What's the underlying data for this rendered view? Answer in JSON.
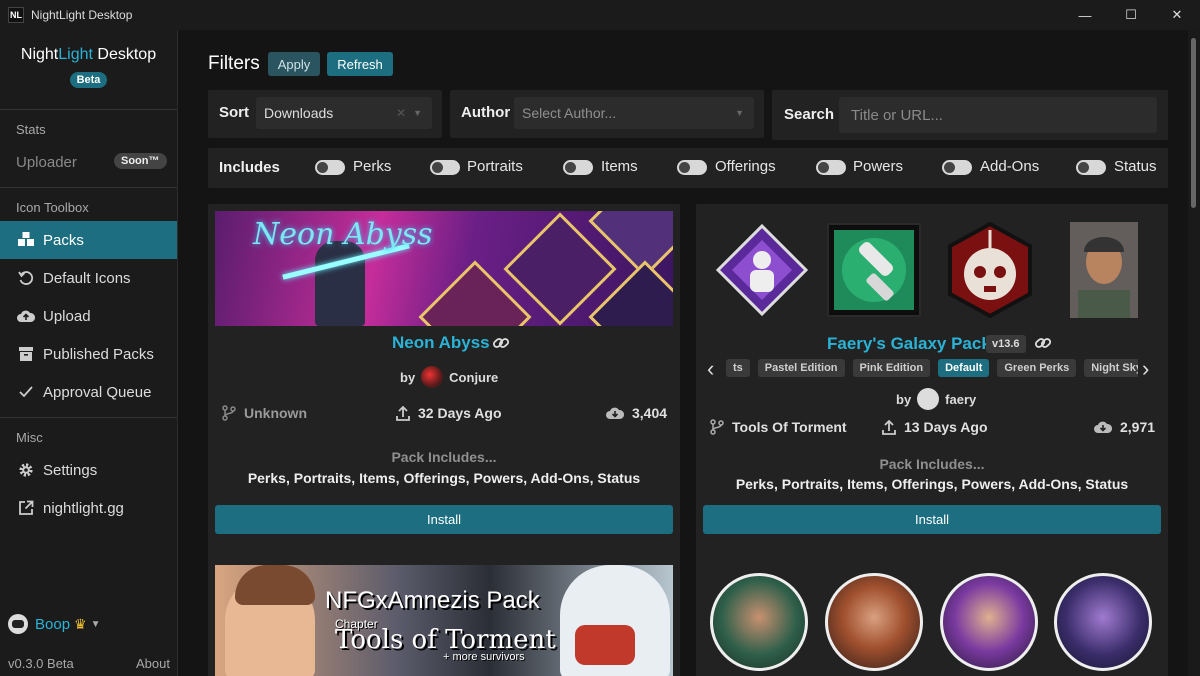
{
  "window": {
    "logo": "NL",
    "title": "NightLight Desktop",
    "minimize": "—",
    "maximize": "☐",
    "close": "✕"
  },
  "sidebar": {
    "brand_part1": "Night",
    "brand_part2": "Light",
    "brand_part3": " Desktop",
    "beta": "Beta",
    "section_stats": "Stats",
    "uploader": "Uploader",
    "soon": "Soon™",
    "section_toolbox": "Icon Toolbox",
    "packs": "Packs",
    "default_icons": "Default Icons",
    "upload": "Upload",
    "published_packs": "Published Packs",
    "approval_queue": "Approval Queue",
    "section_misc": "Misc",
    "settings": "Settings",
    "website": "nightlight.gg",
    "username": "Boop",
    "version": "v0.3.0 Beta",
    "about": "About"
  },
  "filters": {
    "title": "Filters",
    "apply": "Apply",
    "refresh": "Refresh",
    "sort_label": "Sort",
    "sort_value": "Downloads",
    "author_label": "Author",
    "author_placeholder": "Select Author...",
    "search_label": "Search",
    "search_placeholder": "Title or URL...",
    "includes_label": "Includes",
    "toggles": [
      "Perks",
      "Portraits",
      "Items",
      "Offerings",
      "Powers",
      "Add-Ons",
      "Status"
    ]
  },
  "packs": [
    {
      "title_art": "Neon Abyss",
      "name": "Neon Abyss",
      "by": "by",
      "author": "Conjure",
      "chapter": "Unknown",
      "updated": "32 Days Ago",
      "downloads": "3,404",
      "includes_head": "Pack Includes...",
      "includes": "Perks, Portraits, Items, Offerings, Powers, Add-Ons, Status",
      "install": "Install"
    },
    {
      "name": "Faery's Galaxy Pack",
      "version": "v13.6",
      "tags": [
        "ts",
        "Pastel Edition",
        "Pink Edition",
        "Default",
        "Green Perks",
        "Night Sky Perks"
      ],
      "by": "by",
      "author": "faery",
      "chapter": "Tools Of Torment",
      "updated": "13 Days Ago",
      "downloads": "2,971",
      "includes_head": "Pack Includes...",
      "includes": "Perks, Portraits, Items, Offerings, Powers, Add-Ons, Status",
      "install": "Install"
    },
    {
      "banner_title": "NFGxAmnezis Pack",
      "banner_chapter": "Chapter",
      "banner_subtitle": "Tools of Torment",
      "banner_more": "+ more survivors"
    }
  ],
  "colors": {
    "accent": "#1c6e80",
    "link": "#2ab3d6",
    "crown": "#f2c233"
  }
}
